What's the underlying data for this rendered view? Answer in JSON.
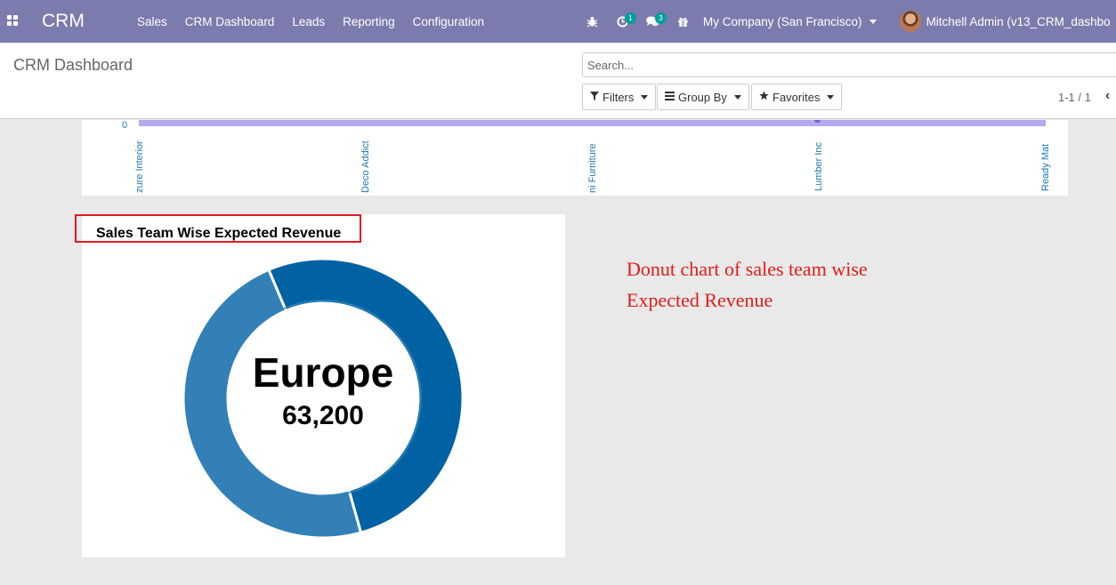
{
  "navbar": {
    "apps_icon": "apps-grid-icon",
    "brand": "CRM",
    "menu": [
      "Sales",
      "CRM Dashboard",
      "Leads",
      "Reporting",
      "Configuration"
    ],
    "activity_badge": "1",
    "messages_badge": "3",
    "company": "My Company (San Francisco)",
    "user": "Mitchell Admin (v13_CRM_dashbo"
  },
  "control_panel": {
    "title": "CRM Dashboard",
    "search_placeholder": "Search...",
    "filters_label": "Filters",
    "group_by_label": "Group By",
    "favorites_label": "Favorites",
    "pager": "1-1 / 1"
  },
  "top_chart": {
    "y_zero_label": "0",
    "x_ticks": [
      "zure Interior",
      "Deco Addict",
      "ni Furniture",
      "Lumber Inc",
      "Ready Mat"
    ],
    "area_color": "#b3aaf0"
  },
  "donut": {
    "title": "Sales Team Wise Expected Revenue",
    "center_label": "Europe",
    "center_value": "63,200"
  },
  "chart_data": {
    "type": "pie",
    "title": "Sales Team Wise Expected Revenue",
    "values": [
      52,
      48
    ],
    "colors": [
      "#0062a3",
      "#3280b7"
    ],
    "highlighted_label": "Europe",
    "highlighted_value": 63200
  },
  "annotation": {
    "line1": "Donut chart of sales team wise",
    "line2": "Expected Revenue"
  }
}
